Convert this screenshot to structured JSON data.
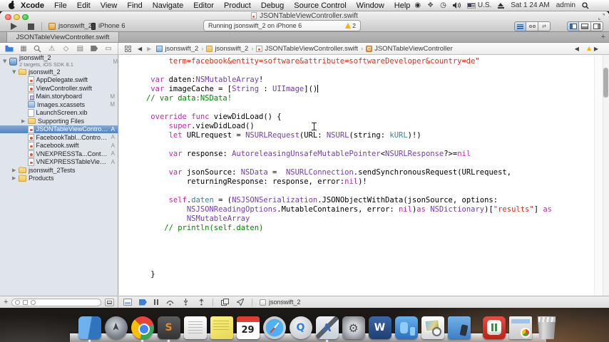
{
  "menu_bar": {
    "items": [
      "Xcode",
      "File",
      "Edit",
      "View",
      "Find",
      "Navigate",
      "Editor",
      "Product",
      "Debug",
      "Source Control",
      "Window",
      "Help"
    ],
    "input_source": "U.S.",
    "clock": "Sat 1 24 AM",
    "user": "admin"
  },
  "window": {
    "title": "JSONTableViewController.swift",
    "toolbar": {
      "scheme": "jsonswift_2",
      "device": "iPhone 6",
      "status_text": "Running jsonswift_2 on iPhone 6",
      "warning_count": "2"
    },
    "tab": "JSONTableViewController.swift",
    "tab_add": "+"
  },
  "navigator": {
    "project": {
      "name": "jsonswift_2",
      "subtitle": "2 targets, iOS SDK 8.1",
      "badge": "M"
    },
    "files": [
      {
        "label": "jsonswift_2",
        "depth": 1,
        "icon": "folder",
        "disclosure": "open",
        "badge": ""
      },
      {
        "label": "AppDelegate.swift",
        "depth": 2,
        "icon": "swift",
        "disclosure": "",
        "badge": ""
      },
      {
        "label": "ViewController.swift",
        "depth": 2,
        "icon": "swift",
        "disclosure": "",
        "badge": ""
      },
      {
        "label": "Main.storyboard",
        "depth": 2,
        "icon": "storyboard",
        "disclosure": "",
        "badge": "M"
      },
      {
        "label": "Images.xcassets",
        "depth": 2,
        "icon": "xcassets",
        "disclosure": "",
        "badge": "M"
      },
      {
        "label": "LaunchScreen.xib",
        "depth": 2,
        "icon": "xib",
        "disclosure": "",
        "badge": ""
      },
      {
        "label": "Supporting Files",
        "depth": 2,
        "icon": "folder",
        "disclosure": "closed",
        "badge": ""
      },
      {
        "label": "JSONTableViewController.swift",
        "depth": 2,
        "icon": "swift",
        "disclosure": "",
        "badge": "A",
        "selected": true
      },
      {
        "label": "FacebookTabl...Controller.swift",
        "depth": 2,
        "icon": "swift",
        "disclosure": "",
        "badge": "A"
      },
      {
        "label": "Facebook.swift",
        "depth": 2,
        "icon": "swift",
        "disclosure": "",
        "badge": "A"
      },
      {
        "label": "VNEXPRESSTa...Controller.swift",
        "depth": 2,
        "icon": "swift",
        "disclosure": "",
        "badge": "A"
      },
      {
        "label": "VNEXPRESSTableViewCell.swift",
        "depth": 2,
        "icon": "swift",
        "disclosure": "",
        "badge": "A"
      },
      {
        "label": "jsonswift_2Tests",
        "depth": 1,
        "icon": "folder",
        "disclosure": "closed",
        "badge": ""
      },
      {
        "label": "Products",
        "depth": 1,
        "icon": "folder",
        "disclosure": "closed",
        "badge": ""
      }
    ]
  },
  "jump_bar": {
    "crumbs": [
      {
        "label": "jsonswift_2",
        "icon": "file-blue",
        "glyph": ""
      },
      {
        "label": "jsonswift_2",
        "icon": "folder",
        "glyph": ""
      },
      {
        "label": "JSONTableViewController.swift",
        "icon": "file-swift",
        "glyph": ""
      },
      {
        "label": "JSONTableViewController",
        "icon": "class",
        "glyph": "C"
      }
    ]
  },
  "editor": {
    "code_lines": [
      [
        {
          "t": "        term=facebook&entity=software&attribute=softwareDeveloper&country=de\"",
          "c": "str"
        }
      ],
      [],
      [
        {
          "t": "    ",
          "c": "p"
        },
        {
          "t": "var",
          "c": "kw"
        },
        {
          "t": " daten:",
          "c": "p"
        },
        {
          "t": "NSMutableArray",
          "c": "type"
        },
        {
          "t": "!",
          "c": "p"
        }
      ],
      [
        {
          "t": "    ",
          "c": "p"
        },
        {
          "t": "var",
          "c": "kw"
        },
        {
          "t": " imageCache = [",
          "c": "p"
        },
        {
          "t": "String",
          "c": "type"
        },
        {
          "t": " : ",
          "c": "p"
        },
        {
          "t": "UIImage",
          "c": "type"
        },
        {
          "t": "]()",
          "c": "p"
        },
        {
          "t": "",
          "c": "caret"
        }
      ],
      [
        {
          "t": "   ",
          "c": "p"
        },
        {
          "t": "// var data:NSData!",
          "c": "cmt"
        }
      ],
      [],
      [
        {
          "t": "    ",
          "c": "p"
        },
        {
          "t": "override func",
          "c": "kw"
        },
        {
          "t": " viewDidLoad() {",
          "c": "p"
        }
      ],
      [
        {
          "t": "        ",
          "c": "p"
        },
        {
          "t": "super",
          "c": "kw"
        },
        {
          "t": ".viewDidLoad()",
          "c": "p"
        }
      ],
      [
        {
          "t": "        ",
          "c": "p"
        },
        {
          "t": "let",
          "c": "kw"
        },
        {
          "t": " URLrequest = ",
          "c": "p"
        },
        {
          "t": "NSURLRequest",
          "c": "type"
        },
        {
          "t": "(URL: ",
          "c": "p"
        },
        {
          "t": "NSURL",
          "c": "type"
        },
        {
          "t": "(string: ",
          "c": "p"
        },
        {
          "t": "kURL",
          "c": "proj"
        },
        {
          "t": ")!)",
          "c": "p"
        }
      ],
      [],
      [
        {
          "t": "        ",
          "c": "p"
        },
        {
          "t": "var",
          "c": "kw"
        },
        {
          "t": " response: ",
          "c": "p"
        },
        {
          "t": "AutoreleasingUnsafeMutablePointer",
          "c": "type"
        },
        {
          "t": "<",
          "c": "p"
        },
        {
          "t": "NSURLResponse",
          "c": "type"
        },
        {
          "t": "?>=",
          "c": "p"
        },
        {
          "t": "nil",
          "c": "kw"
        }
      ],
      [],
      [
        {
          "t": "        ",
          "c": "p"
        },
        {
          "t": "var",
          "c": "kw"
        },
        {
          "t": " jsonSource: ",
          "c": "p"
        },
        {
          "t": "NSData",
          "c": "type"
        },
        {
          "t": " =  ",
          "c": "p"
        },
        {
          "t": "NSURLConnection",
          "c": "type"
        },
        {
          "t": ".sendSynchronousRequest(URLrequest,",
          "c": "p"
        }
      ],
      [
        {
          "t": "            returningResponse: response, error:",
          "c": "p"
        },
        {
          "t": "nil",
          "c": "kw"
        },
        {
          "t": ")!",
          "c": "p"
        }
      ],
      [],
      [
        {
          "t": "        ",
          "c": "p"
        },
        {
          "t": "self",
          "c": "kw"
        },
        {
          "t": ".",
          "c": "p"
        },
        {
          "t": "daten",
          "c": "proj"
        },
        {
          "t": " = (",
          "c": "p"
        },
        {
          "t": "NSJSONSerialization",
          "c": "type"
        },
        {
          "t": ".JSONObjectWithData(jsonSource, options:",
          "c": "p"
        }
      ],
      [
        {
          "t": "            ",
          "c": "p"
        },
        {
          "t": "NSJSONReadingOptions",
          "c": "type"
        },
        {
          "t": ".MutableContainers, error: ",
          "c": "p"
        },
        {
          "t": "nil",
          "c": "kw"
        },
        {
          "t": ")",
          "c": "p"
        },
        {
          "t": "as",
          "c": "kw"
        },
        {
          "t": " ",
          "c": "p"
        },
        {
          "t": "NSDictionary",
          "c": "type"
        },
        {
          "t": ")[",
          "c": "p"
        },
        {
          "t": "\"results\"",
          "c": "str"
        },
        {
          "t": "] ",
          "c": "p"
        },
        {
          "t": "as",
          "c": "kw"
        }
      ],
      [
        {
          "t": "            ",
          "c": "p"
        },
        {
          "t": "NSMutableArray",
          "c": "type"
        }
      ],
      [
        {
          "t": "       ",
          "c": "p"
        },
        {
          "t": "// println(self.daten)",
          "c": "cmt"
        }
      ],
      [],
      [],
      [],
      [],
      [
        {
          "t": "    }",
          "c": "p"
        }
      ]
    ]
  },
  "debug_bar": {
    "process": "jsonswift_2"
  },
  "dock": {
    "items": [
      {
        "name": "finder",
        "glyph": "",
        "running": true
      },
      {
        "name": "launchpad",
        "glyph": ""
      },
      {
        "name": "chrome",
        "glyph": "",
        "running": true
      },
      {
        "name": "sublime-text",
        "glyph": "S",
        "running": true
      },
      {
        "name": "textedit",
        "glyph": ""
      },
      {
        "name": "stickies",
        "glyph": ""
      },
      {
        "name": "calendar",
        "glyph": "29"
      },
      {
        "name": "safari",
        "glyph": ""
      },
      {
        "name": "quicktime",
        "glyph": "Q"
      },
      {
        "name": "xcode",
        "glyph": "A",
        "running": true
      },
      {
        "name": "system-preferences",
        "glyph": "⚙"
      },
      {
        "name": "word",
        "glyph": "W"
      },
      {
        "name": "blue-app",
        "glyph": ""
      },
      {
        "name": "photos",
        "glyph": ""
      },
      {
        "name": "developer-folder",
        "glyph": ""
      },
      {
        "name": "separator",
        "glyph": ""
      },
      {
        "name": "chef-app",
        "glyph": ""
      },
      {
        "name": "chrome-window",
        "glyph": ""
      },
      {
        "name": "trash",
        "glyph": ""
      }
    ]
  },
  "colors": {
    "keyword": "#bb2ca2",
    "type": "#703daa",
    "string": "#d12f1b",
    "comment": "#008400",
    "project_symbol": "#3e8087",
    "selection": "#5282bc"
  }
}
